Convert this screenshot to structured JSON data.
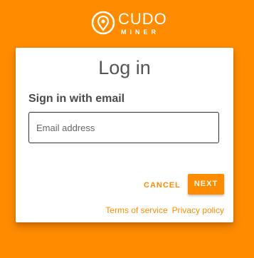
{
  "brand": {
    "name": "CUDO",
    "sub": "MINER",
    "logo_icon": "cudo-logo-icon"
  },
  "login": {
    "title": "Log in",
    "subtitle": "Sign in with email",
    "email_placeholder": "Email address",
    "email_value": "",
    "cancel_label": "CANCEL",
    "next_label": "NEXT",
    "terms_label": "Terms of service",
    "privacy_label": "Privacy policy"
  },
  "colors": {
    "accent": "#FF8C00",
    "card": "#FFFFFF",
    "text_dark": "#4A4A4A"
  }
}
